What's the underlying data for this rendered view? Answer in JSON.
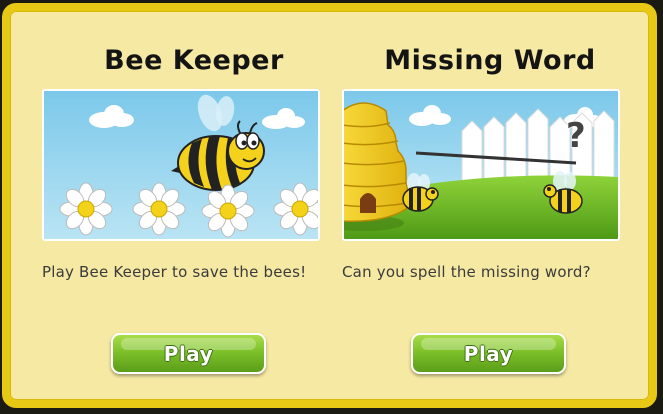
{
  "games": [
    {
      "title": "Bee Keeper",
      "description": "Play Bee Keeper to save the bees!",
      "play_label": "Play"
    },
    {
      "title": "Missing Word",
      "description": "Can you spell the missing word?",
      "play_label": "Play",
      "thumbnail_symbol": "?"
    }
  ],
  "colors": {
    "frame_border": "#e7c814",
    "panel_background": "#f5e9a3",
    "button_green": "#7dc12a",
    "sky_blue": "#8fd0ec"
  }
}
